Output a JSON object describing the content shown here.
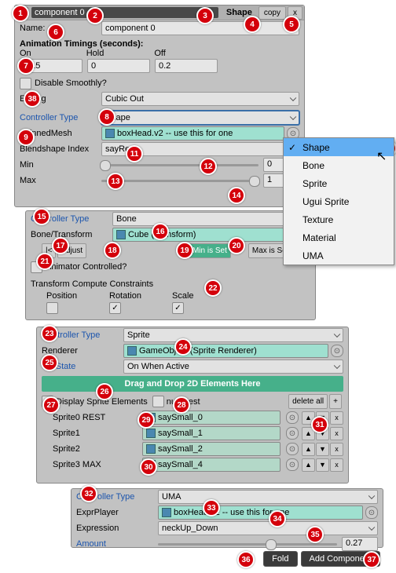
{
  "component": {
    "title_input": "component 0",
    "type_label": "Shape",
    "copy_label": "copy",
    "close_label": "x",
    "name_label": "Name:",
    "name_value": "component 0",
    "timings_header": "Animation Timings (seconds):",
    "on_label": "On",
    "hold_label": "Hold",
    "off_label": "Off",
    "on_val": "0.15",
    "hold_val": "0",
    "off_val": "0.2",
    "disable_smoothly_label": "Disable Smoothly?",
    "easing_label": "Easing",
    "easing_value": "Cubic Out"
  },
  "shape_ctrl": {
    "controller_type_label": "Controller Type",
    "controller_type_value": "Shape",
    "skinnedmesh_label": "SkinnedMesh",
    "skinnedmesh_value": "boxHead.v2 -- use this for one",
    "blendshape_label": "Blendshape Index",
    "blendshape_value": "sayRest",
    "min_label": "Min",
    "min_val": "0",
    "max_label": "Max",
    "max_val": "1"
  },
  "dropdown": {
    "items": [
      "Shape",
      "Bone",
      "Sprite",
      "Ugui Sprite",
      "Texture",
      "Material",
      "UMA"
    ]
  },
  "bone_ctrl": {
    "controller_type_label": "Controller Type",
    "controller_type_value": "Bone",
    "bone_transform_label": "Bone/Transform",
    "bone_transform_value": "Cube (Transform)",
    "prev_btn": "|<",
    "adjust_btn": "adjust",
    "min_set_btn": "Min is Set",
    "max_set_btn": "Max is Set",
    "next_btn": ">|",
    "animator_controlled_label": "Animator Controlled?",
    "constraints_header": "Transform Compute Constraints",
    "pos_label": "Position",
    "rot_label": "Rotation",
    "scale_label": "Scale"
  },
  "sprite_ctrl": {
    "controller_type_label": "Controller Type",
    "controller_type_value": "Sprite",
    "renderer_label": "Renderer",
    "renderer_value": "GameObject (Sprite Renderer)",
    "on_state_label": "On State",
    "on_state_value": "On When Active",
    "dropzone_label": "Drag and Drop 2D Elements Here",
    "display_sprite_label": "Display Sprite Elements",
    "null_rest_label": "null Rest",
    "delete_all_label": "delete all",
    "add_label": "+",
    "rows": [
      {
        "label": "Sprite0 REST",
        "value": "saySmall_0"
      },
      {
        "label": "Sprite1",
        "value": "saySmall_1"
      },
      {
        "label": "Sprite2",
        "value": "saySmall_2"
      },
      {
        "label": "Sprite3 MAX",
        "value": "saySmall_4"
      }
    ]
  },
  "uma_ctrl": {
    "controller_type_label": "Controller Type",
    "controller_type_value": "UMA",
    "expr_player_label": "ExprPlayer",
    "expr_player_value": "boxHead.v2 -- use this for one",
    "expression_label": "Expression",
    "expression_value": "neckUp_Down",
    "amount_label": "Amount",
    "amount_value": "0.27"
  },
  "footer": {
    "fold_label": "Fold",
    "add_label": "Add Component"
  }
}
